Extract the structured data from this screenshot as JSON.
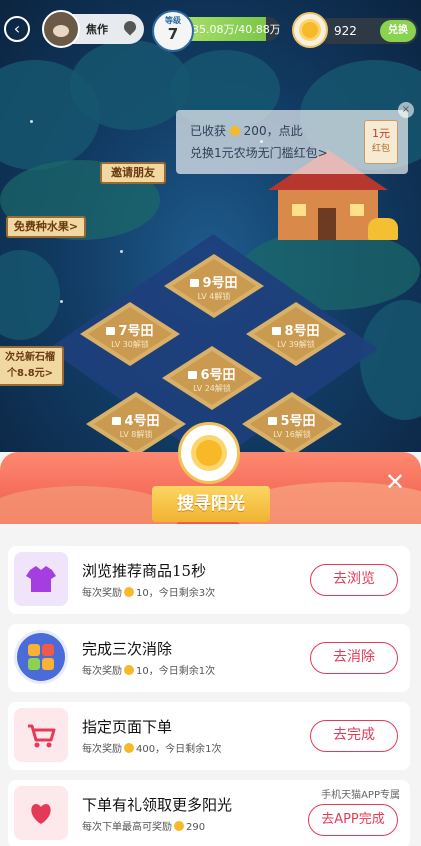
{
  "header": {
    "profile_name": "焦作",
    "level_title": "等级",
    "level_value": "7",
    "progress_text": "35.08万/40.88万",
    "progress_fraction": 0.86,
    "sun_count": "922",
    "exchange_label": "兑换"
  },
  "notice": {
    "line1_prefix": "已收获",
    "line1_amount": "200",
    "line1_suffix": "，点此",
    "line2": "兑换1元农场无门槛红包>",
    "coupon_amount": "1元",
    "coupon_label": "红包"
  },
  "signs": {
    "plant": "免费种水果>",
    "invite": "邀请朋友",
    "promo_line1": "次兑新石榴",
    "promo_line2": "个8.8元>"
  },
  "plots": [
    {
      "title": "9号田",
      "sub": "LV 4解锁"
    },
    {
      "title": "7号田",
      "sub": "LV 30解锁"
    },
    {
      "title": "8号田",
      "sub": "LV 39解锁"
    },
    {
      "title": "6号田",
      "sub": "LV 24解锁"
    },
    {
      "title": "4号田",
      "sub": "LV 8解锁"
    },
    {
      "title": "5号田",
      "sub": "LV 16解锁"
    }
  ],
  "sheet": {
    "title": "搜寻阳光",
    "close_label": "✕"
  },
  "tasks": [
    {
      "title": "浏览推荐商品15秒",
      "desc_prefix": "每次奖励",
      "desc_suffix": "10，今日剩余3次",
      "button": "去浏览",
      "icon": "tshirt-icon",
      "color": "#a43ee0"
    },
    {
      "title": "完成三次消除",
      "desc_prefix": "每次奖励",
      "desc_suffix": "10，今日剩余1次",
      "button": "去消除",
      "icon": "match-game-icon",
      "color": "#4a6bd8"
    },
    {
      "title": "指定页面下单",
      "desc_prefix": "每次奖励",
      "desc_suffix": "400，今日剩余1次",
      "button": "去完成",
      "icon": "cart-icon",
      "color": "#e53a57"
    },
    {
      "title": "下单有礼领取更多阳光",
      "desc_prefix": "每次下单最高可奖励",
      "desc_suffix": "290",
      "button": "去APP完成",
      "note": "手机天猫APP专属",
      "icon": "heart-icon",
      "color": "#e53a57"
    }
  ]
}
